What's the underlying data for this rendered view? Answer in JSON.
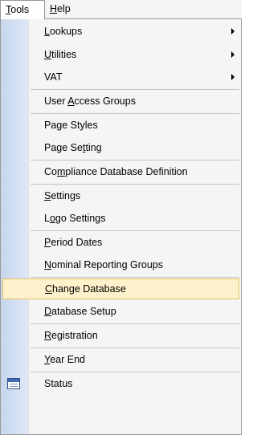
{
  "menubar": {
    "tools": {
      "pre": "",
      "key": "T",
      "post": "ools"
    },
    "help": {
      "pre": "",
      "key": "H",
      "post": "elp"
    }
  },
  "menu": {
    "lookups": {
      "pre": "",
      "key": "L",
      "post": "ookups"
    },
    "utilities": {
      "pre": "",
      "key": "U",
      "post": "tilities"
    },
    "vat": {
      "pre": "VAT",
      "key": "",
      "post": ""
    },
    "user_access_groups": {
      "pre": "User ",
      "key": "A",
      "post": "ccess Groups"
    },
    "page_styles": {
      "pre": "Page Styles",
      "key": "",
      "post": ""
    },
    "page_setting": {
      "pre": "Page Se",
      "key": "t",
      "post": "ting"
    },
    "compliance_db_def": {
      "pre": "Co",
      "key": "m",
      "post": "pliance Database Definition"
    },
    "settings": {
      "pre": "",
      "key": "S",
      "post": "ettings"
    },
    "logo_settings": {
      "pre": "L",
      "key": "o",
      "post": "go Settings"
    },
    "period_dates": {
      "pre": "",
      "key": "P",
      "post": "eriod Dates"
    },
    "nominal_reporting_groups": {
      "pre": "",
      "key": "N",
      "post": "ominal Reporting Groups"
    },
    "change_database": {
      "pre": "",
      "key": "C",
      "post": "hange Database"
    },
    "database_setup": {
      "pre": "",
      "key": "D",
      "post": "atabase Setup"
    },
    "registration": {
      "pre": "",
      "key": "R",
      "post": "egistration"
    },
    "year_end": {
      "pre": "",
      "key": "Y",
      "post": "ear End"
    },
    "status": {
      "pre": "Status",
      "key": "",
      "post": ""
    }
  },
  "colors": {
    "highlight": "#fef2cc",
    "highlight_border": "#e5c365",
    "gutter": "#c7d6ee"
  },
  "icons": {
    "status": "status-window-icon",
    "submenu": "submenu-arrow-icon"
  }
}
